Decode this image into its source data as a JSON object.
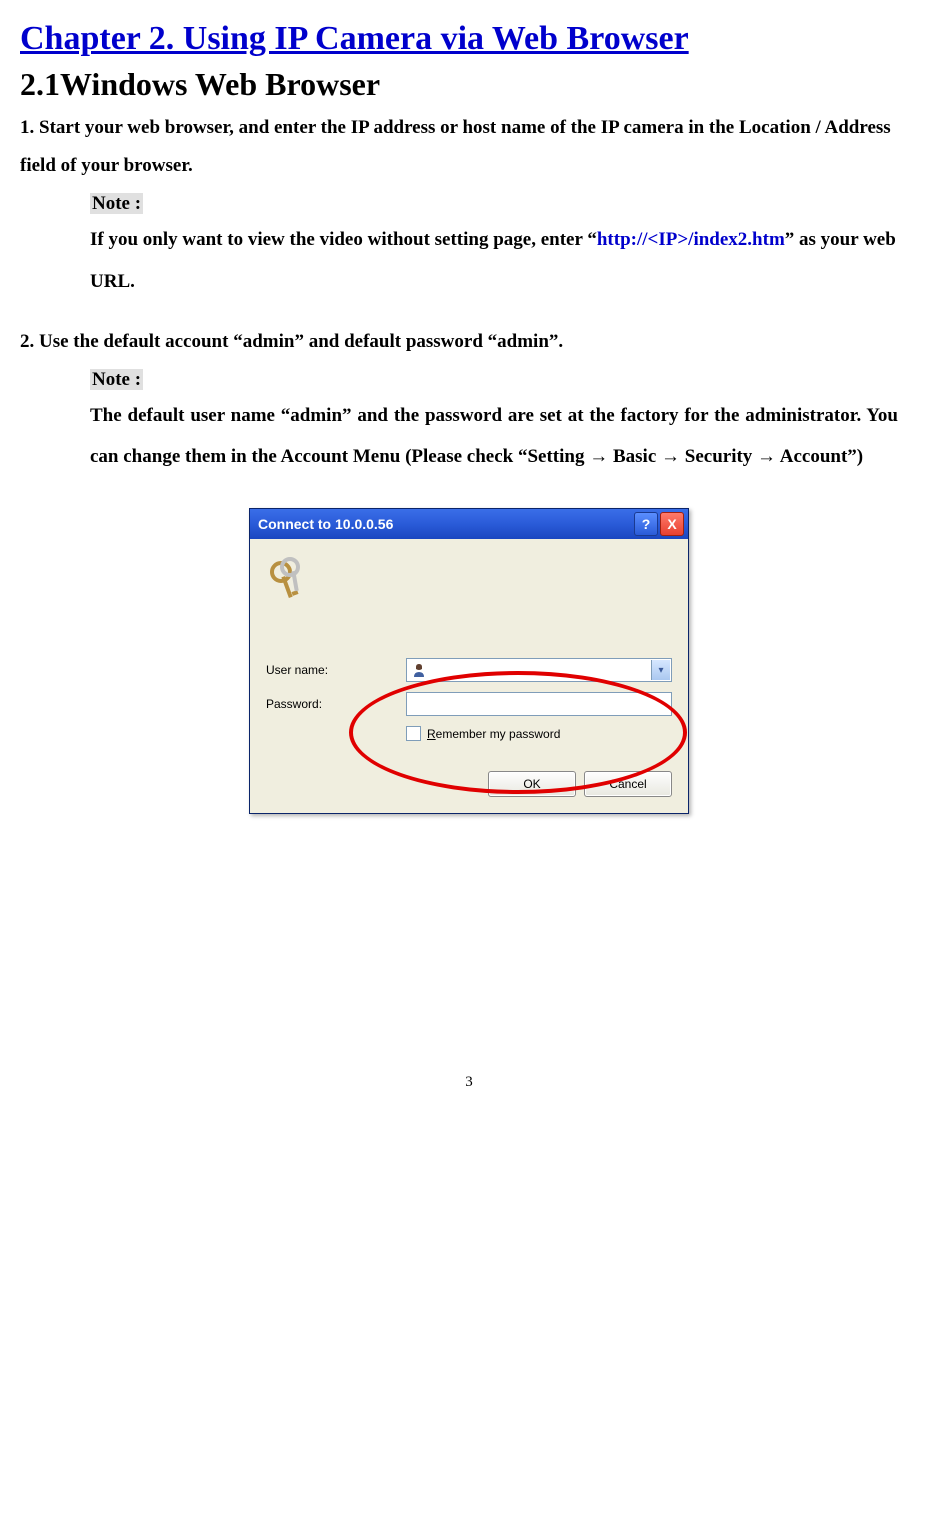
{
  "chapter_title": "Chapter 2. Using IP Camera via Web Browser",
  "section_title": "2.1Windows Web Browser",
  "step1": "1. Start your web browser, and enter the IP address or host name of the IP camera in the Location / Address field of your browser.",
  "note1": {
    "label": "Note :",
    "text_before": "If you only want to view the video without setting page, enter “",
    "url": "http://<IP>/index2.htm",
    "text_after": "” as your web URL."
  },
  "step2": "2. Use the default account “admin” and default password “admin”.",
  "note2": {
    "label": "Note :",
    "text": "The default user name “admin” and the password are set at the factory for the administrator. You can change them in the Account Menu (Please check “Setting → Basic → Security → Account”)"
  },
  "dialog": {
    "title": "Connect to 10.0.0.56",
    "help_label": "?",
    "close_label": "X",
    "username_label": "User name:",
    "password_label": "Password:",
    "remember_label": "Remember my password",
    "remember_underline_char": "R",
    "ok_label": "OK",
    "cancel_label": "Cancel"
  },
  "page_number": "3"
}
